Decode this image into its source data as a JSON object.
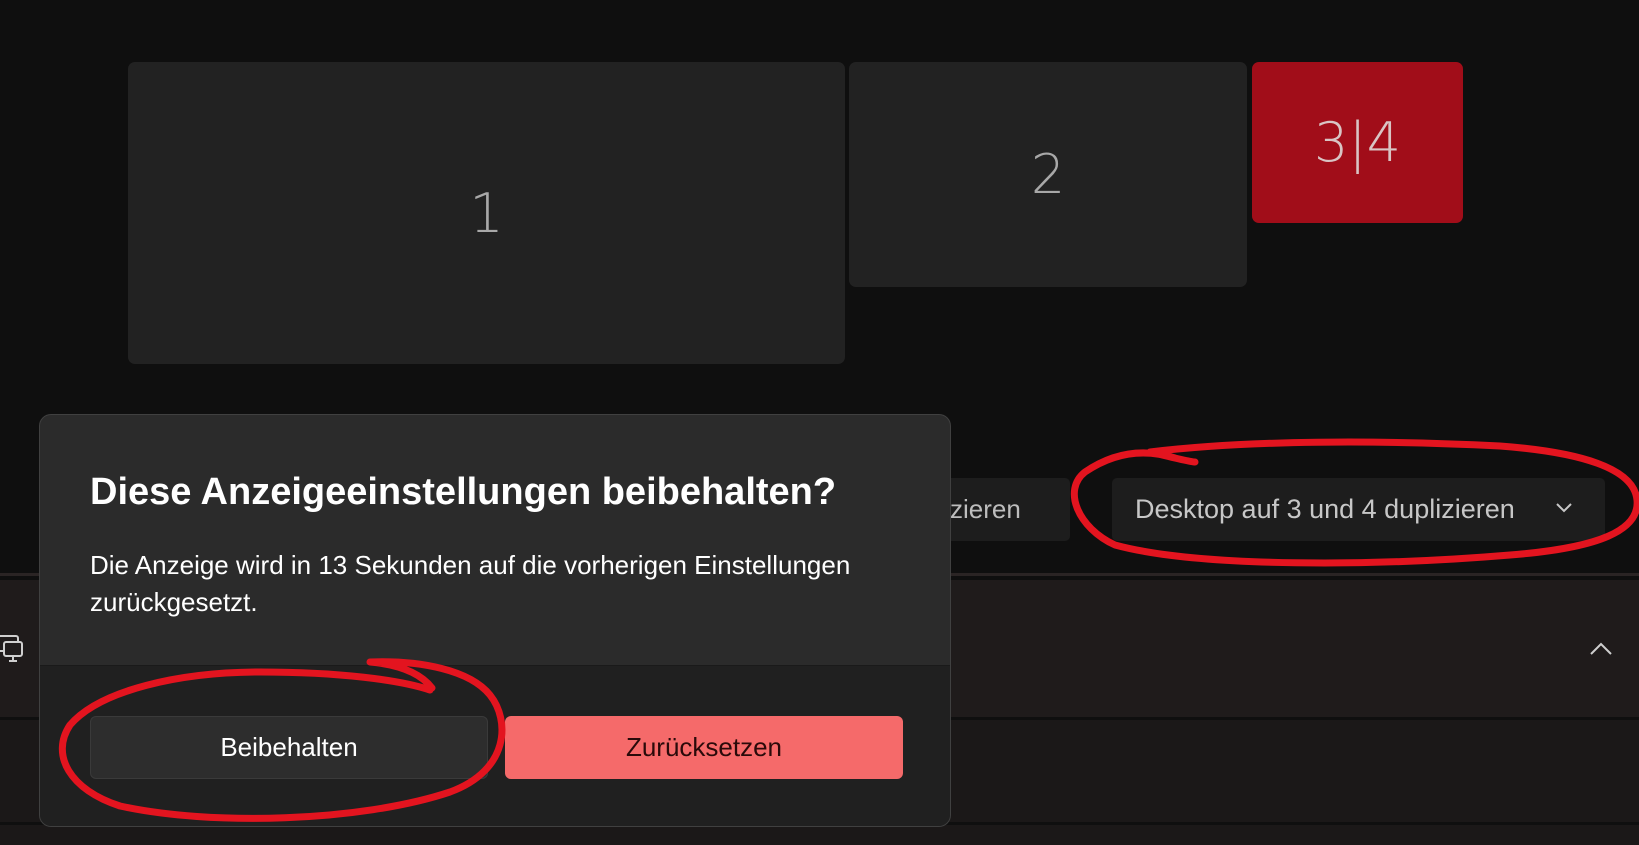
{
  "monitors": [
    {
      "label": "1"
    },
    {
      "label": "2"
    },
    {
      "label": "3|4",
      "selected": true
    }
  ],
  "controls": {
    "partial_button_label": "zieren",
    "dropdown_value": "Desktop auf 3 und 4 duplizieren"
  },
  "dialog": {
    "title": "Diese Anzeigeeinstellungen beibehalten?",
    "body": "Die Anzeige wird in 13 Sekunden auf die vorherigen Einstellungen zurückgesetzt.",
    "keep_label": "Beibehalten",
    "reset_label": "Zurücksetzen"
  },
  "colors": {
    "selected_monitor": "#a10d19",
    "reset_button": "#f56a6a",
    "annotation": "#e3141f"
  },
  "icons": {
    "dropdown": "chevron-down-icon",
    "settings_row": "multi-display-icon",
    "expand": "chevron-up-icon"
  }
}
